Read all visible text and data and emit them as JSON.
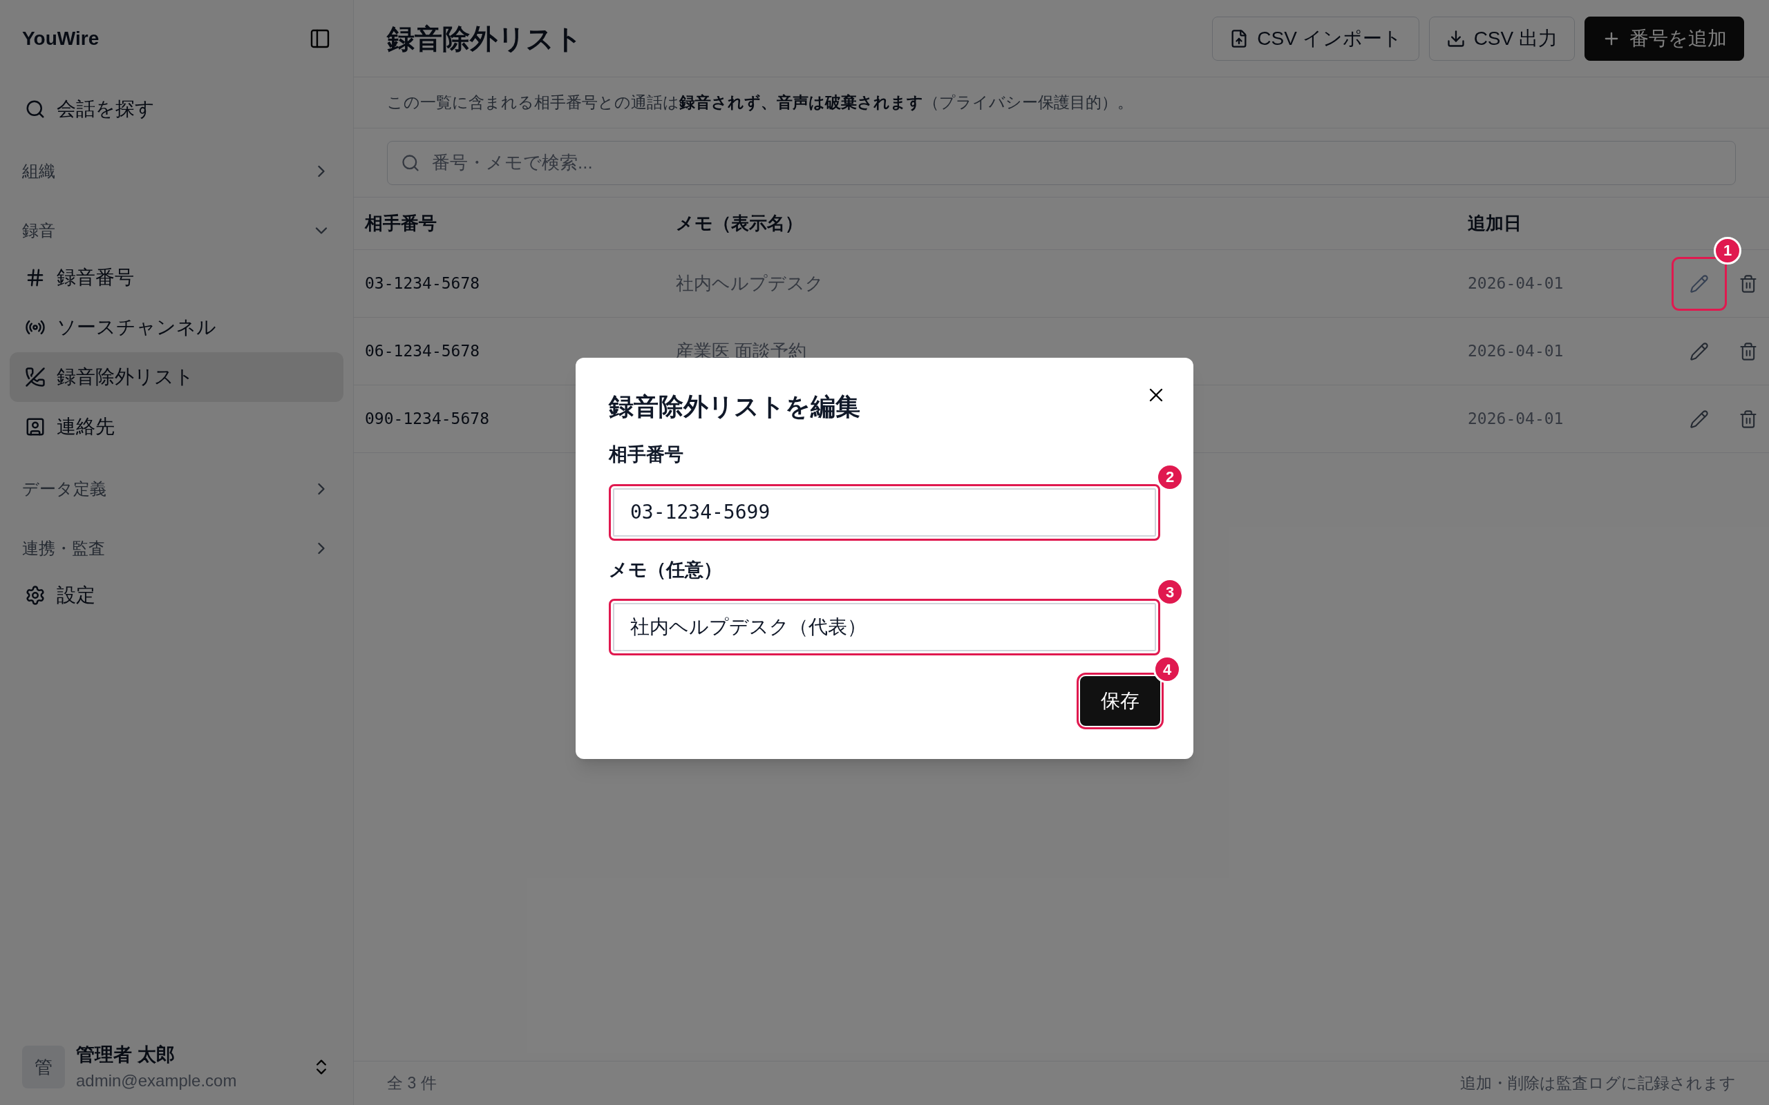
{
  "sidebar": {
    "brand": "YouWire",
    "nav": [
      {
        "kind": "link",
        "label": "会話を探す",
        "selected": false
      },
      {
        "kind": "group",
        "label": "組織",
        "expanded": false
      },
      {
        "kind": "group",
        "label": "録音",
        "expanded": true,
        "children": [
          {
            "kind": "link",
            "label": "録音番号",
            "selected": false
          },
          {
            "kind": "link",
            "label": "ソースチャンネル",
            "selected": false
          },
          {
            "kind": "link",
            "label": "録音除外リスト",
            "selected": true
          },
          {
            "kind": "link",
            "label": "連絡先",
            "selected": false
          }
        ]
      },
      {
        "kind": "group",
        "label": "データ定義",
        "expanded": false
      },
      {
        "kind": "group",
        "label": "連携・監査",
        "expanded": false
      },
      {
        "kind": "link",
        "label": "設定",
        "selected": false
      }
    ],
    "user": {
      "avatar": "管",
      "name": "管理者 太郎",
      "email": "admin@example.com"
    }
  },
  "header": {
    "title": "録音除外リスト",
    "buttons": [
      {
        "kind": "outline",
        "label": "CSV インポート"
      },
      {
        "kind": "outline",
        "label": "CSV 出力"
      },
      {
        "kind": "primary",
        "label": "番号を追加"
      }
    ]
  },
  "description": "この一覧に含まれる相手番号との通話は**録音されず、音声は破棄されます**（プライバシー保護目的）。",
  "search": {
    "placeholder": "番号・メモで検索..."
  },
  "table": {
    "columns": [
      "相手番号",
      "メモ（表示名）",
      "追加日"
    ],
    "rows": [
      {
        "number": "03-1234-5678",
        "memo": "社内ヘルプデスク",
        "date": "2026-04-01",
        "callout": "1"
      },
      {
        "number": "06-1234-5678",
        "memo": "産業医 面談予約",
        "date": "2026-04-01"
      },
      {
        "number": "090-1234-5678",
        "date": "2026-04-01"
      }
    ]
  },
  "footer": {
    "count": "全 3 件",
    "note": "追加・削除は監査ログに記録されます"
  },
  "dialog": {
    "title": "録音除外リストを編集",
    "fields": [
      {
        "kind": "number",
        "label": "相手番号",
        "value": "03-1234-5699",
        "callout": "2"
      },
      {
        "kind": "text",
        "label": "メモ（任意）",
        "value": "社内ヘルプデスク（代表）",
        "callout": "3"
      }
    ],
    "save": {
      "label": "保存",
      "callout": "4"
    }
  }
}
